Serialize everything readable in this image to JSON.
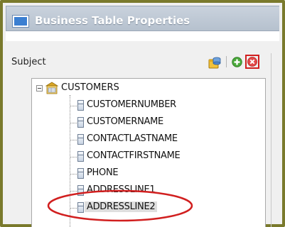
{
  "window": {
    "title": "Business Table Properties"
  },
  "panel": {
    "subject_label": "Subject",
    "toolbar": {
      "icons": [
        "database-import-icon",
        "add-icon",
        "delete-icon"
      ]
    }
  },
  "tree": {
    "root": {
      "label": "CUSTOMERS",
      "expanded": true,
      "icon": "table-icon"
    },
    "columns": [
      "CUSTOMERNUMBER",
      "CUSTOMERNAME",
      "CONTACTLASTNAME",
      "CONTACTFIRSTNAME",
      "PHONE",
      "ADDRESSLINE1",
      "ADDRESSLINE2"
    ],
    "selected": "ADDRESSLINE2"
  },
  "colors": {
    "frame_border": "#7a7a2c",
    "highlight_red": "#d11f1f",
    "selection_bg": "#dedede"
  }
}
